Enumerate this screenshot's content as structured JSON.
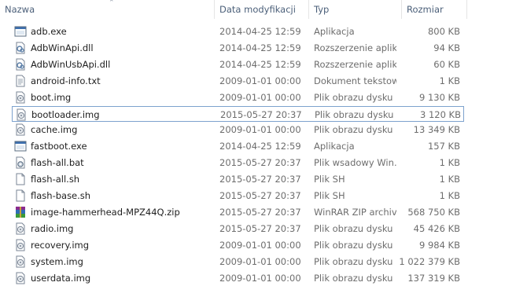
{
  "columns": {
    "name": "Nazwa",
    "date": "Data modyfikacji",
    "type": "Typ",
    "size": "Rozmiar"
  },
  "files": [
    {
      "name": "adb.exe",
      "date": "2014-04-25 12:59",
      "type": "Aplikacja",
      "size": "800 KB",
      "icon": "exe-icon"
    },
    {
      "name": "AdbWinApi.dll",
      "date": "2014-04-25 12:59",
      "type": "Rozszerzenie aplik…",
      "size": "94 KB",
      "icon": "dll-icon"
    },
    {
      "name": "AdbWinUsbApi.dll",
      "date": "2014-04-25 12:59",
      "type": "Rozszerzenie aplik…",
      "size": "60 KB",
      "icon": "dll-icon"
    },
    {
      "name": "android-info.txt",
      "date": "2009-01-01 00:00",
      "type": "Dokument tekstowy",
      "size": "1 KB",
      "icon": "text-file-icon"
    },
    {
      "name": "boot.img",
      "date": "2009-01-01 00:00",
      "type": "Plik obrazu dysku",
      "size": "9 130 KB",
      "icon": "disk-image-icon"
    },
    {
      "name": "bootloader.img",
      "date": "2015-05-27 20:37",
      "type": "Plik obrazu dysku",
      "size": "3 120 KB",
      "icon": "disk-image-icon"
    },
    {
      "name": "cache.img",
      "date": "2009-01-01 00:00",
      "type": "Plik obrazu dysku",
      "size": "13 349 KB",
      "icon": "disk-image-icon"
    },
    {
      "name": "fastboot.exe",
      "date": "2014-04-25 12:59",
      "type": "Aplikacja",
      "size": "157 KB",
      "icon": "exe-icon"
    },
    {
      "name": "flash-all.bat",
      "date": "2015-05-27 20:37",
      "type": "Plik wsadowy Win…",
      "size": "1 KB",
      "icon": "batch-file-icon"
    },
    {
      "name": "flash-all.sh",
      "date": "2015-05-27 20:37",
      "type": "Plik SH",
      "size": "1 KB",
      "icon": "blank-file-icon"
    },
    {
      "name": "flash-base.sh",
      "date": "2015-05-27 20:37",
      "type": "Plik SH",
      "size": "1 KB",
      "icon": "blank-file-icon"
    },
    {
      "name": "image-hammerhead-MPZ44Q.zip",
      "date": "2015-05-27 20:37",
      "type": "WinRAR ZIP archive",
      "size": "568 750 KB",
      "icon": "winrar-archive-icon"
    },
    {
      "name": "radio.img",
      "date": "2015-05-27 20:37",
      "type": "Plik obrazu dysku",
      "size": "45 426 KB",
      "icon": "disk-image-icon"
    },
    {
      "name": "recovery.img",
      "date": "2009-01-01 00:00",
      "type": "Plik obrazu dysku",
      "size": "9 984 KB",
      "icon": "disk-image-icon"
    },
    {
      "name": "system.img",
      "date": "2009-01-01 00:00",
      "type": "Plik obrazu dysku",
      "size": "1 022 379 KB",
      "icon": "disk-image-icon"
    },
    {
      "name": "userdata.img",
      "date": "2009-01-01 00:00",
      "type": "Plik obrazu dysku",
      "size": "137 319 KB",
      "icon": "disk-image-icon"
    }
  ],
  "selected_index": 5,
  "colors": {
    "header_text": "#4c607a",
    "selection_border": "#7da2ce",
    "secondary_text": "#6d6d6d"
  }
}
